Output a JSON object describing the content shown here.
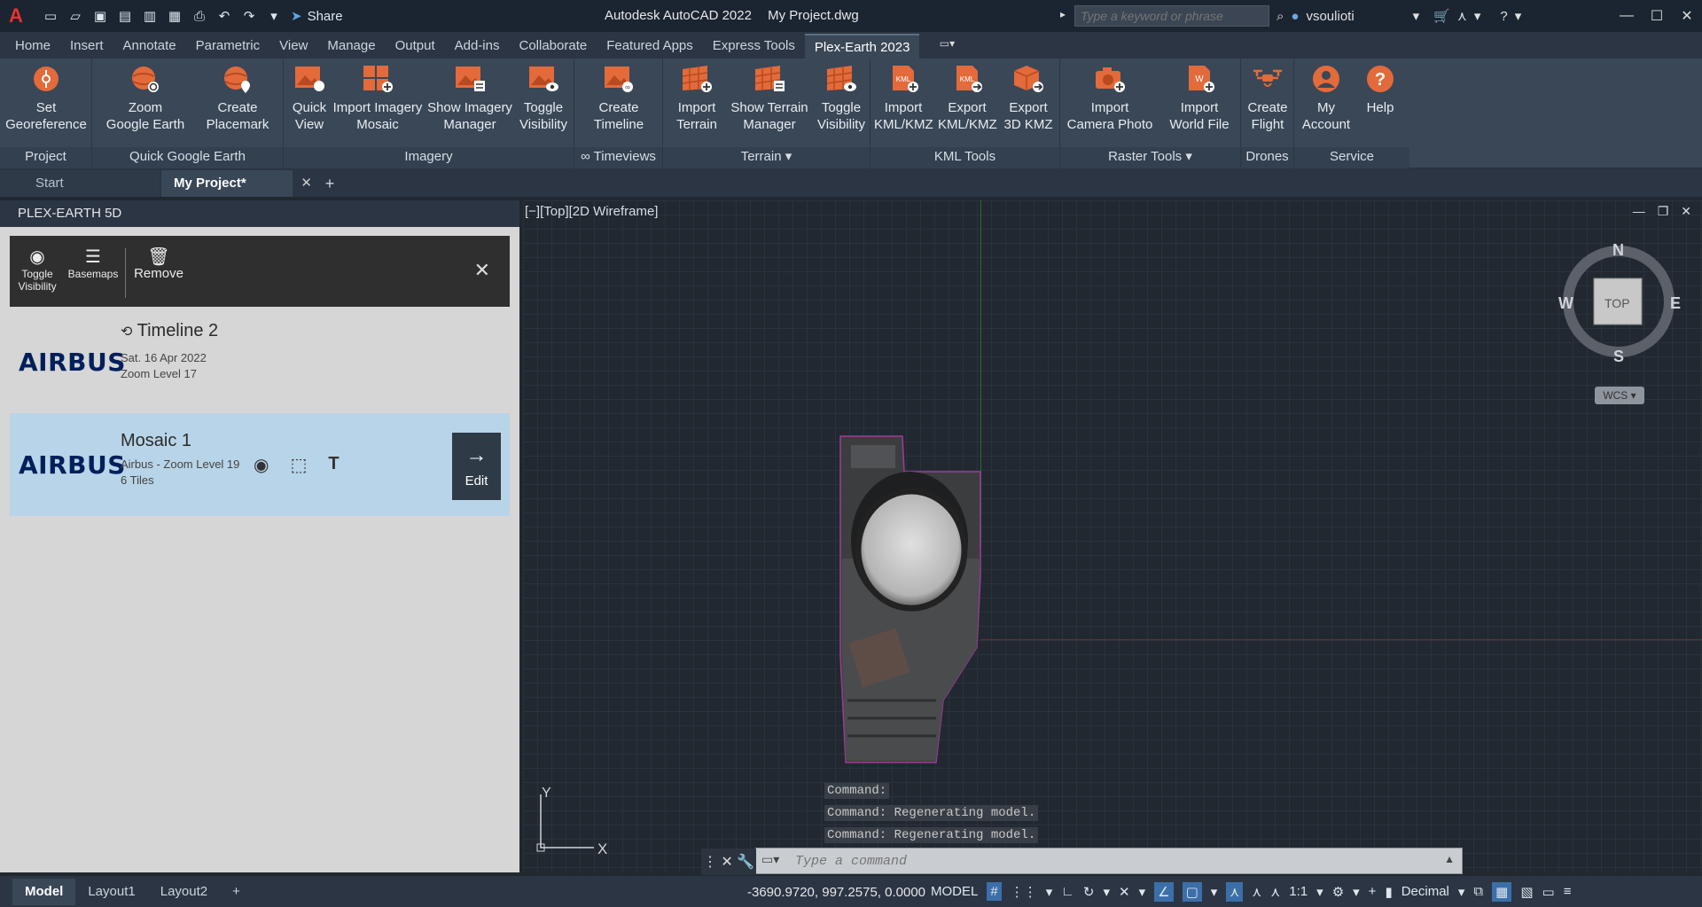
{
  "window": {
    "title_app": "Autodesk AutoCAD 2022",
    "title_file": "My Project.dwg",
    "share_label": "Share",
    "search_placeholder": "Type a keyword or phrase",
    "username": "vsoulioti"
  },
  "ribbon_tabs": [
    "Home",
    "Insert",
    "Annotate",
    "Parametric",
    "View",
    "Manage",
    "Output",
    "Add-ins",
    "Collaborate",
    "Featured Apps",
    "Express Tools",
    "Plex-Earth 2023"
  ],
  "ribbon": {
    "groups": {
      "project": "Project",
      "quick_google_earth": "Quick Google Earth",
      "imagery": "Imagery",
      "timeviews": "∞ Timeviews",
      "terrain": "Terrain",
      "kml_tools": "KML Tools",
      "raster_tools": "Raster Tools",
      "drones": "Drones",
      "service": "Service"
    },
    "buttons": {
      "set_georeference": [
        "Set",
        "Georeference"
      ],
      "zoom_google_earth": [
        "Zoom",
        "Google Earth"
      ],
      "create_placemark": [
        "Create",
        "Placemark"
      ],
      "quick_view": [
        "Quick",
        "View"
      ],
      "import_imagery_mosaic": [
        "Import Imagery",
        "Mosaic"
      ],
      "show_imagery_manager": [
        "Show Imagery",
        "Manager"
      ],
      "toggle_visibility_imagery": [
        "Toggle",
        "Visibility"
      ],
      "create_timeline": [
        "Create",
        "Timeline"
      ],
      "import_terrain": [
        "Import",
        "Terrain"
      ],
      "show_terrain_manager": [
        "Show Terrain",
        "Manager"
      ],
      "toggle_visibility_terrain": [
        "Toggle",
        "Visibility"
      ],
      "import_kml": [
        "Import",
        "KML/KMZ"
      ],
      "export_kml": [
        "Export",
        "KML/KMZ"
      ],
      "export_3d_kmz": [
        "Export",
        "3D KMZ"
      ],
      "import_camera_photo": [
        "Import",
        "Camera Photo"
      ],
      "import_world_file": [
        "Import",
        "World File"
      ],
      "create_flight": [
        "Create",
        "Flight"
      ],
      "my_account": [
        "My",
        "Account"
      ],
      "help": [
        "Help",
        ""
      ]
    }
  },
  "doc_tabs": {
    "start": "Start",
    "active": "My Project*"
  },
  "palette": {
    "title": "PLEX-EARTH 5D",
    "toolbar": {
      "toggle_visibility": [
        "Toggle",
        "Visibility"
      ],
      "basemaps": "Basemaps",
      "remove": "Remove"
    },
    "items": [
      {
        "provider": "AIRBUS",
        "title": "Timeline 2",
        "date": "Sat. 16 Apr 2022",
        "detail": "Zoom Level 17"
      },
      {
        "provider": "AIRBUS",
        "title": "Mosaic 1",
        "date": "Airbus - Zoom Level 19",
        "detail": "6 Tiles",
        "edit_label": "Edit"
      }
    ]
  },
  "viewport": {
    "label": "[−][Top][2D Wireframe]",
    "viewcube": {
      "n": "N",
      "s": "S",
      "e": "E",
      "w": "W",
      "top": "TOP",
      "wcs": "WCS"
    },
    "ucs_x": "X",
    "ucs_y": "Y",
    "command_history": [
      "Command:",
      "Command: Regenerating model.",
      "Command: Regenerating model."
    ],
    "command_placeholder": "Type a command"
  },
  "statusbar": {
    "tabs": [
      "Model",
      "Layout1",
      "Layout2"
    ],
    "coords": "-3690.9720, 997.2575, 0.0000",
    "model_label": "MODEL",
    "scale": "1:1",
    "units": "Decimal"
  },
  "colors": {
    "accent_orange": "#e36a3a",
    "ribbon_bg": "#3a4757",
    "selected_item": "#b8d4e8",
    "airbus_navy": "#00205b"
  }
}
